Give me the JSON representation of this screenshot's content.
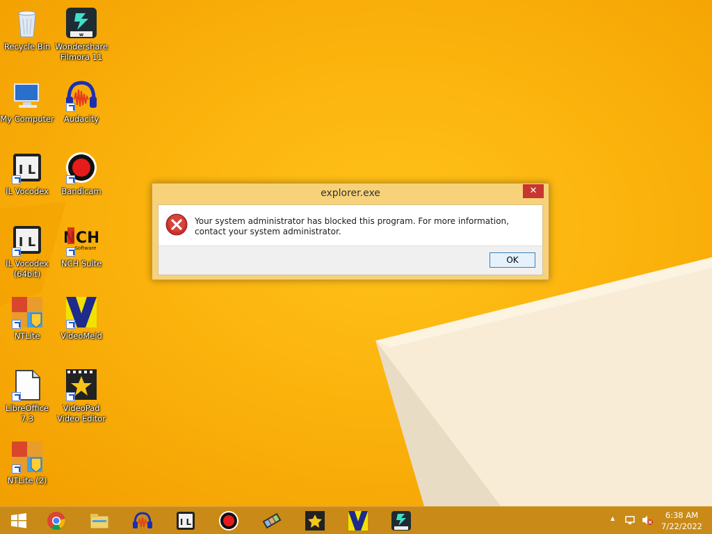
{
  "desktop": {
    "icons": [
      {
        "label": "Recycle Bin",
        "icon": "recycle-bin-icon"
      },
      {
        "label": "Wondershare\nFilmora 11",
        "icon": "filmora-icon"
      },
      {
        "label": "My Computer",
        "icon": "my-computer-icon"
      },
      {
        "label": "Audacity",
        "icon": "audacity-icon"
      },
      {
        "label": "IL Vocodex",
        "icon": "il-vocodex-icon"
      },
      {
        "label": "Bandicam",
        "icon": "bandicam-icon"
      },
      {
        "label": "IL Vocodex\n(64bit)",
        "icon": "il-vocodex-icon"
      },
      {
        "label": "NCH Suite",
        "icon": "nch-suite-icon"
      },
      {
        "label": "NTLite",
        "icon": "ntlite-icon"
      },
      {
        "label": "VideoMeld",
        "icon": "videomeld-icon"
      },
      {
        "label": "LibreOffice\n7.3",
        "icon": "libreoffice-icon"
      },
      {
        "label": "VideoPad\nVideo Editor",
        "icon": "videopad-icon"
      },
      {
        "label": "NTLite (2)",
        "icon": "ntlite-icon"
      }
    ]
  },
  "dialog": {
    "title": "explorer.exe",
    "close_label": "✕",
    "message": "Your system administrator has blocked this program. For more information, contact your system administrator.",
    "ok_label": "OK",
    "icon": "error-icon"
  },
  "taskbar": {
    "items": [
      "start-icon",
      "chrome-icon",
      "file-explorer-icon",
      "audacity-icon",
      "il-vocodex-icon",
      "bandicam-icon",
      "film-icon",
      "videopad-icon",
      "videomeld-icon",
      "filmora-icon"
    ],
    "clock_time": "6:38 AM",
    "clock_date": "7/22/2022",
    "tray_chevron": "▲"
  },
  "colors": {
    "wallpaper": "#f6a800",
    "dialog_frame": "#f7d27a",
    "close_button": "#c7372f",
    "taskbar": "#c98a17"
  }
}
